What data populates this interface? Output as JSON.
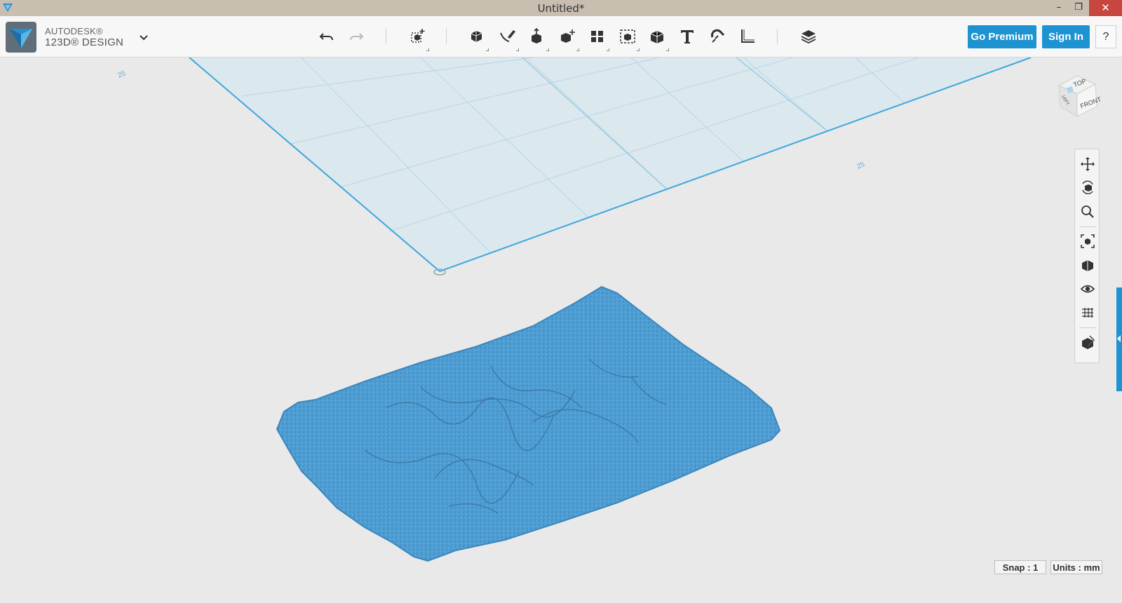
{
  "window": {
    "title": "Untitled*",
    "minimize": "–",
    "maximize": "❐",
    "close": "✕"
  },
  "brand": {
    "line1": "AUTODESK®",
    "line2": "123D® DESIGN"
  },
  "toolbar": {
    "undo": "undo-icon",
    "redo": "redo-icon",
    "tools": [
      "transform-icon",
      "primitives-icon",
      "sketch-icon",
      "construct-icon",
      "modify-icon",
      "pattern-icon",
      "group-icon",
      "combine-icon",
      "measure-icon",
      "text-icon",
      "snap-icon",
      "material-icon",
      "layers-icon"
    ],
    "go_premium": "Go Premium",
    "sign_in": "Sign In",
    "help": "?"
  },
  "viewport": {
    "grid_label_left": "25",
    "grid_label_right": "25",
    "viewcube": {
      "top": "TOP",
      "front": "FRONT",
      "left": "LEFT"
    },
    "accent": "#5aaed6",
    "model_color": "#4f9fd5"
  },
  "nav": {
    "items": [
      "pan-icon",
      "orbit-icon",
      "zoom-icon",
      "fit-icon",
      "views-icon",
      "visibility-icon",
      "grid-icon",
      "material-shading-icon"
    ]
  },
  "status": {
    "snap": "Snap : 1",
    "units": "Units : mm"
  }
}
